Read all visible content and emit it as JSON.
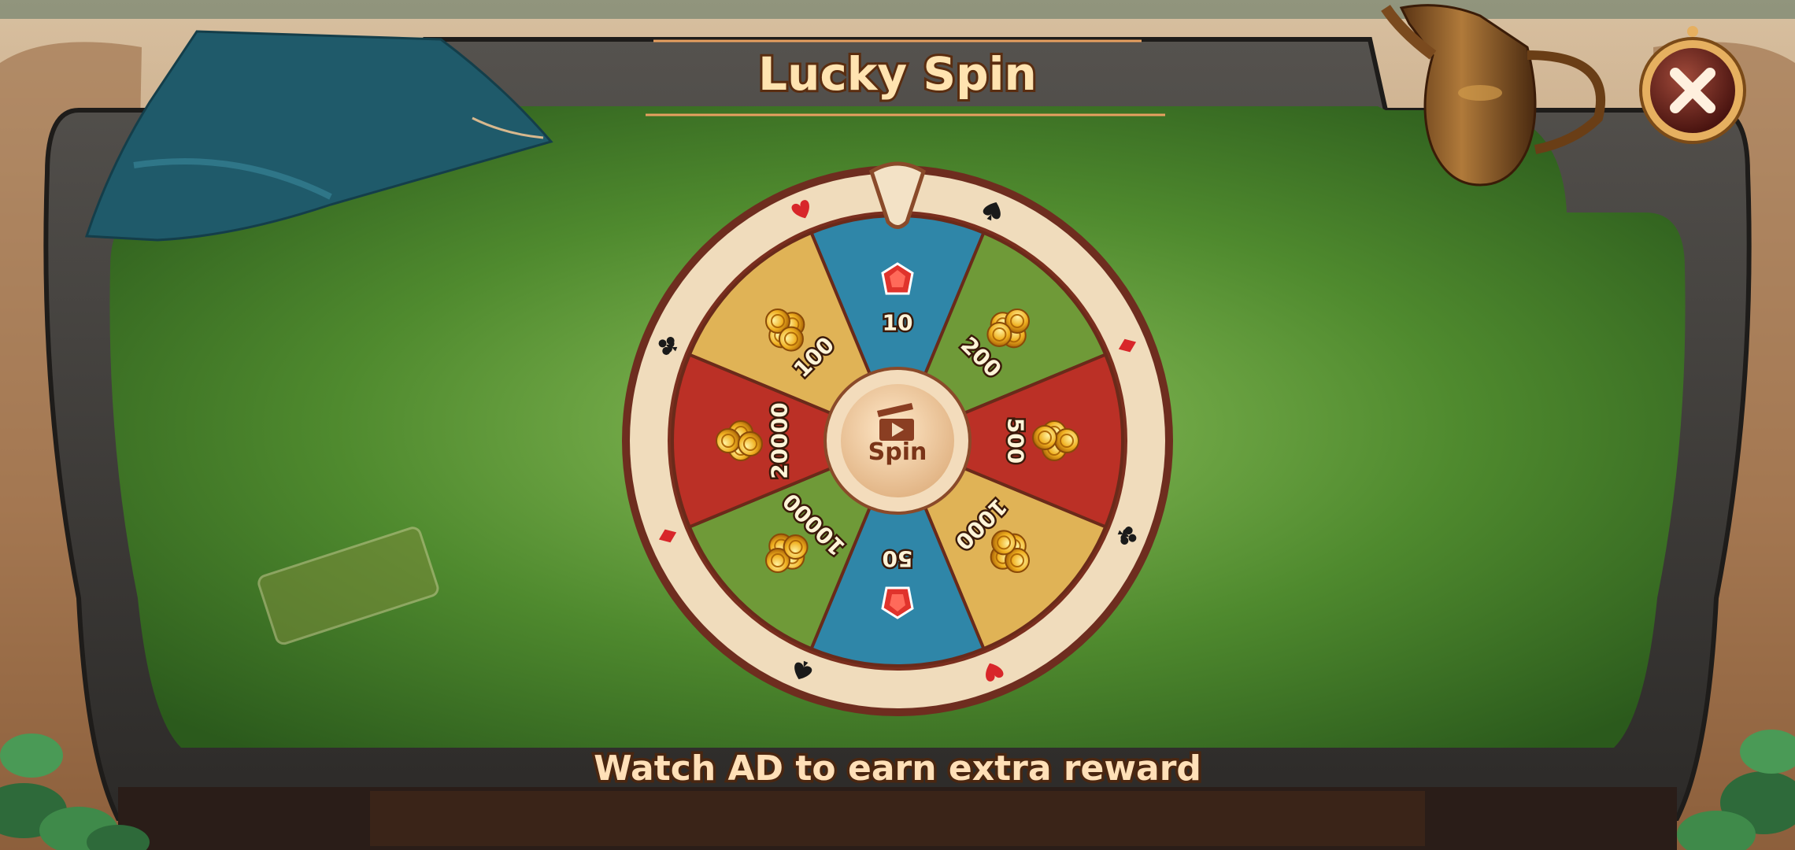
{
  "title": "Lucky Spin",
  "footer": "Watch AD to earn extra reward",
  "spin_button": {
    "label": "Spin",
    "icon": "video-ad-icon"
  },
  "close_button": {
    "icon": "close-icon"
  },
  "wheel": {
    "segments": [
      {
        "label": "10",
        "reward": "gem",
        "color": "#2f86a8"
      },
      {
        "label": "200",
        "reward": "coins",
        "color": "#6f9a38"
      },
      {
        "label": "500",
        "reward": "coins",
        "color": "#bb3026"
      },
      {
        "label": "1000",
        "reward": "coins",
        "color": "#e0b356"
      },
      {
        "label": "50",
        "reward": "gem",
        "color": "#2f86a8"
      },
      {
        "label": "10000",
        "reward": "coins",
        "color": "#6f9a38"
      },
      {
        "label": "20000",
        "reward": "coins",
        "color": "#bb3026"
      },
      {
        "label": "100",
        "reward": "coins",
        "color": "#e0b356"
      }
    ],
    "suit_markers": [
      {
        "suit": "spade",
        "color": "#1a1a1a"
      },
      {
        "suit": "diamond",
        "color": "#d8262a"
      },
      {
        "suit": "club",
        "color": "#1a1a1a"
      },
      {
        "suit": "heart",
        "color": "#d8262a"
      },
      {
        "suit": "spade",
        "color": "#1a1a1a"
      },
      {
        "suit": "diamond",
        "color": "#d8262a"
      },
      {
        "suit": "club",
        "color": "#1a1a1a"
      },
      {
        "suit": "heart",
        "color": "#d8262a"
      }
    ]
  },
  "colors": {
    "felt": "#4f8a2e",
    "frame": "#3d3a37",
    "wheel_rim": "#f0dcbc",
    "wheel_rim_dark": "#6e2d1f",
    "text_accent": "#ffe3b0"
  }
}
